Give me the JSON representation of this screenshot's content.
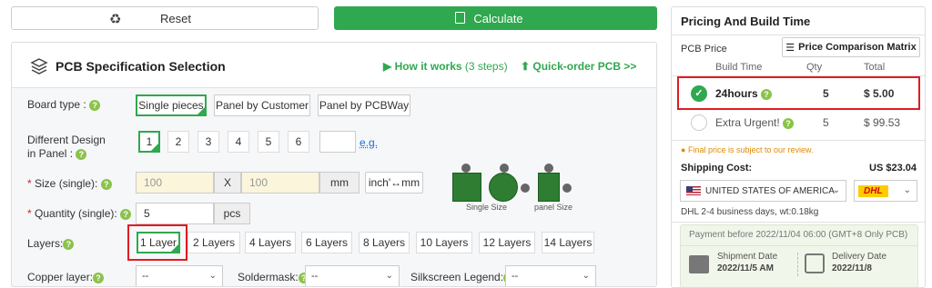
{
  "top": {
    "reset_label": "Reset",
    "calculate_label": "Calculate"
  },
  "spec": {
    "title": "PCB Specification Selection",
    "how_it_works": "How it works",
    "how_steps": "(3 steps)",
    "quick_order": "Quick-order PCB >>",
    "board_type": {
      "label": "Board type :",
      "options": [
        "Single pieces",
        "Panel by Customer",
        "Panel by PCBWay"
      ]
    },
    "different_design": {
      "label_line1": "Different Design",
      "label_line2": "in Panel :",
      "options": [
        "1",
        "2",
        "3",
        "4",
        "5",
        "6"
      ],
      "eg": "e.g."
    },
    "size": {
      "label": "Size (single):",
      "w_placeholder": "100",
      "x": "X",
      "h_placeholder": "100",
      "unit": "mm",
      "convert": "inch'↔mm"
    },
    "quantity": {
      "label": "Quantity (single):",
      "value": "5",
      "unit": "pcs"
    },
    "layers": {
      "label": "Layers:",
      "options": [
        "1 Layer",
        "2 Layers",
        "4 Layers",
        "6 Layers",
        "8 Layers",
        "10 Layers",
        "12 Layers",
        "14 Layers"
      ]
    },
    "copper": {
      "label": "Copper layer:",
      "value": "--"
    },
    "soldermask": {
      "label": "Soldermask:",
      "value": "--"
    },
    "silkscreen": {
      "label": "Silkscreen Legend:",
      "value": "--"
    },
    "illustrations": {
      "single": "Single Size",
      "panel": "panel Size"
    }
  },
  "pricing": {
    "title": "Pricing And Build Time",
    "pcb_price": "PCB Price",
    "compare": "Price Comparison Matrix",
    "headers": [
      "Build Time",
      "Qty",
      "Total"
    ],
    "rows": [
      {
        "name": "24hours",
        "qty": "5",
        "total": "$ 5.00"
      },
      {
        "name": "Extra Urgent!",
        "qty": "5",
        "total": "$ 99.53"
      }
    ],
    "note": "Final price is subject to our review.",
    "shipping_label": "Shipping Cost:",
    "shipping_value": "US $23.04",
    "country": "UNITED STATES OF AMERICA",
    "carrier": "DHL",
    "dhl_info": "DHL  2-4 business days, wt:0.18kg",
    "payment_before": "Payment before 2022/11/04 06:00 (GMT+8 Only PCB)",
    "shipment_label": "Shipment Date",
    "shipment_date": "2022/11/5 AM",
    "delivery_label": "Delivery Date",
    "delivery_date": "2022/11/8"
  },
  "colors": {
    "green": "#2fa84f",
    "red": "#e11b22",
    "accent": "#8bc34a"
  }
}
